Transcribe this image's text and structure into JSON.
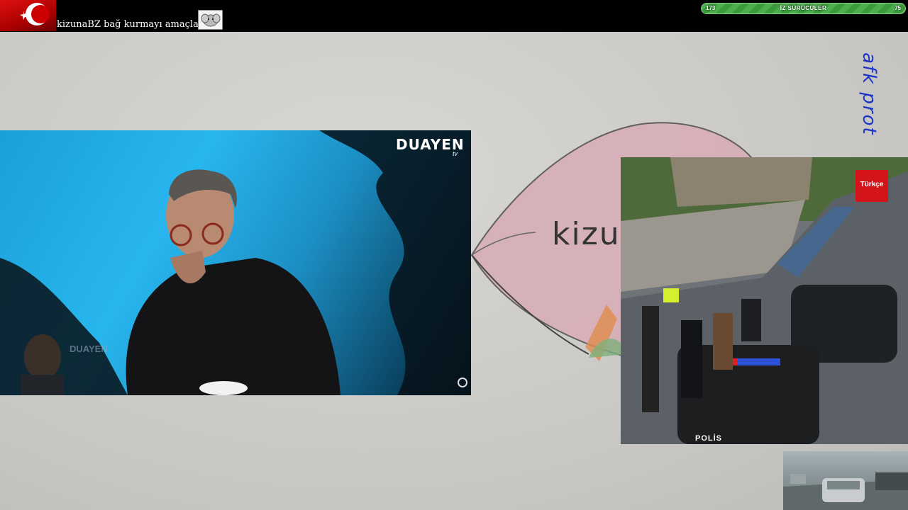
{
  "topbar": {
    "ticker_text": "kizunaBZ bağ kurmayı amaçlar",
    "flag_icon": "turkish-flag-icon",
    "emote_icon": "elephant-emote-icon"
  },
  "goal": {
    "current": "173",
    "label": "İZ SÜRÜCÜLER",
    "target": "75",
    "fill_fraction": 1.0,
    "color": "#4cae4c"
  },
  "overlay": {
    "afk_text": "afk prot"
  },
  "drawing": {
    "text": "kizu"
  },
  "camera_studio": {
    "channel_logo": "DUAYEN",
    "channel_logo_suffix": "tv",
    "watermark": "DUAYEN"
  },
  "camera_street": {
    "badge_text": "Türkçe",
    "vehicle_text": "POLİS"
  },
  "colors": {
    "topbar": "#000000",
    "afk_text": "#1a34c8",
    "badge": "#d3151b"
  }
}
